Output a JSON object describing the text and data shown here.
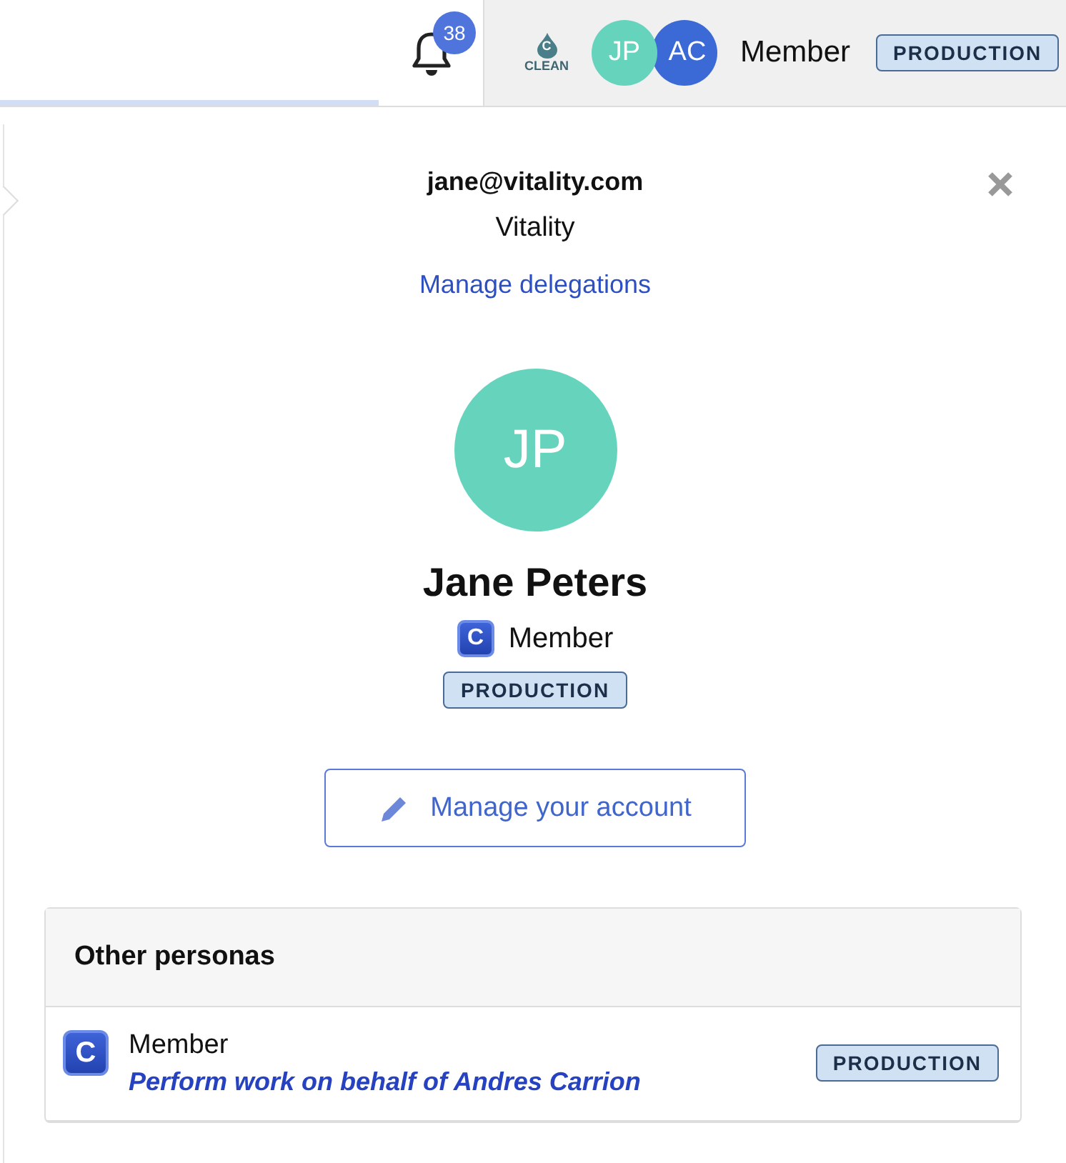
{
  "topbar": {
    "notifications": {
      "count": "38"
    },
    "logo": {
      "letter": "C",
      "label": "CLEAN"
    },
    "avatars": [
      {
        "initials": "JP",
        "color": "#66d4bd"
      },
      {
        "initials": "AC",
        "color": "#3b6ad6"
      }
    ],
    "role": "Member",
    "environment": "PRODUCTION"
  },
  "profile": {
    "email": "jane@vitality.com",
    "organization": "Vitality",
    "manage_delegations": "Manage delegations",
    "avatar_initials": "JP",
    "name": "Jane Peters",
    "role_badge": "C",
    "role": "Member",
    "environment": "PRODUCTION",
    "manage_account": "Manage your account"
  },
  "other_personas": {
    "title": "Other personas",
    "items": [
      {
        "badge": "C",
        "role": "Member",
        "action": "Perform work on behalf of Andres Carrion",
        "environment": "PRODUCTION"
      }
    ]
  }
}
